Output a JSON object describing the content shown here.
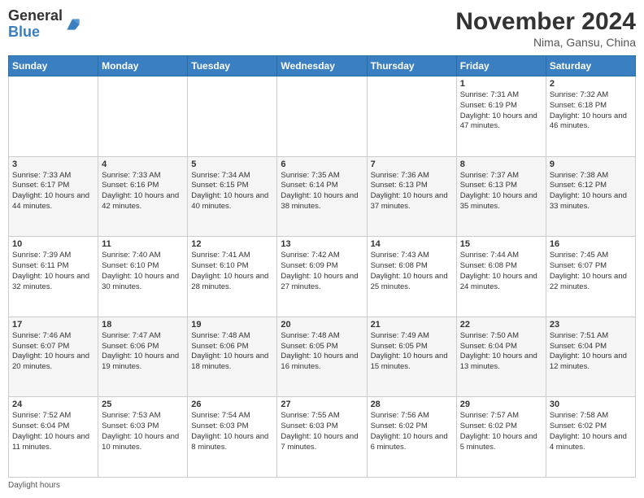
{
  "logo": {
    "general": "General",
    "blue": "Blue"
  },
  "header": {
    "title": "November 2024",
    "subtitle": "Nima, Gansu, China"
  },
  "days_of_week": [
    "Sunday",
    "Monday",
    "Tuesday",
    "Wednesday",
    "Thursday",
    "Friday",
    "Saturday"
  ],
  "weeks": [
    [
      {
        "day": "",
        "info": ""
      },
      {
        "day": "",
        "info": ""
      },
      {
        "day": "",
        "info": ""
      },
      {
        "day": "",
        "info": ""
      },
      {
        "day": "",
        "info": ""
      },
      {
        "day": "1",
        "info": "Sunrise: 7:31 AM\nSunset: 6:19 PM\nDaylight: 10 hours and 47 minutes."
      },
      {
        "day": "2",
        "info": "Sunrise: 7:32 AM\nSunset: 6:18 PM\nDaylight: 10 hours and 46 minutes."
      }
    ],
    [
      {
        "day": "3",
        "info": "Sunrise: 7:33 AM\nSunset: 6:17 PM\nDaylight: 10 hours and 44 minutes."
      },
      {
        "day": "4",
        "info": "Sunrise: 7:33 AM\nSunset: 6:16 PM\nDaylight: 10 hours and 42 minutes."
      },
      {
        "day": "5",
        "info": "Sunrise: 7:34 AM\nSunset: 6:15 PM\nDaylight: 10 hours and 40 minutes."
      },
      {
        "day": "6",
        "info": "Sunrise: 7:35 AM\nSunset: 6:14 PM\nDaylight: 10 hours and 38 minutes."
      },
      {
        "day": "7",
        "info": "Sunrise: 7:36 AM\nSunset: 6:13 PM\nDaylight: 10 hours and 37 minutes."
      },
      {
        "day": "8",
        "info": "Sunrise: 7:37 AM\nSunset: 6:13 PM\nDaylight: 10 hours and 35 minutes."
      },
      {
        "day": "9",
        "info": "Sunrise: 7:38 AM\nSunset: 6:12 PM\nDaylight: 10 hours and 33 minutes."
      }
    ],
    [
      {
        "day": "10",
        "info": "Sunrise: 7:39 AM\nSunset: 6:11 PM\nDaylight: 10 hours and 32 minutes."
      },
      {
        "day": "11",
        "info": "Sunrise: 7:40 AM\nSunset: 6:10 PM\nDaylight: 10 hours and 30 minutes."
      },
      {
        "day": "12",
        "info": "Sunrise: 7:41 AM\nSunset: 6:10 PM\nDaylight: 10 hours and 28 minutes."
      },
      {
        "day": "13",
        "info": "Sunrise: 7:42 AM\nSunset: 6:09 PM\nDaylight: 10 hours and 27 minutes."
      },
      {
        "day": "14",
        "info": "Sunrise: 7:43 AM\nSunset: 6:08 PM\nDaylight: 10 hours and 25 minutes."
      },
      {
        "day": "15",
        "info": "Sunrise: 7:44 AM\nSunset: 6:08 PM\nDaylight: 10 hours and 24 minutes."
      },
      {
        "day": "16",
        "info": "Sunrise: 7:45 AM\nSunset: 6:07 PM\nDaylight: 10 hours and 22 minutes."
      }
    ],
    [
      {
        "day": "17",
        "info": "Sunrise: 7:46 AM\nSunset: 6:07 PM\nDaylight: 10 hours and 20 minutes."
      },
      {
        "day": "18",
        "info": "Sunrise: 7:47 AM\nSunset: 6:06 PM\nDaylight: 10 hours and 19 minutes."
      },
      {
        "day": "19",
        "info": "Sunrise: 7:48 AM\nSunset: 6:06 PM\nDaylight: 10 hours and 18 minutes."
      },
      {
        "day": "20",
        "info": "Sunrise: 7:48 AM\nSunset: 6:05 PM\nDaylight: 10 hours and 16 minutes."
      },
      {
        "day": "21",
        "info": "Sunrise: 7:49 AM\nSunset: 6:05 PM\nDaylight: 10 hours and 15 minutes."
      },
      {
        "day": "22",
        "info": "Sunrise: 7:50 AM\nSunset: 6:04 PM\nDaylight: 10 hours and 13 minutes."
      },
      {
        "day": "23",
        "info": "Sunrise: 7:51 AM\nSunset: 6:04 PM\nDaylight: 10 hours and 12 minutes."
      }
    ],
    [
      {
        "day": "24",
        "info": "Sunrise: 7:52 AM\nSunset: 6:04 PM\nDaylight: 10 hours and 11 minutes."
      },
      {
        "day": "25",
        "info": "Sunrise: 7:53 AM\nSunset: 6:03 PM\nDaylight: 10 hours and 10 minutes."
      },
      {
        "day": "26",
        "info": "Sunrise: 7:54 AM\nSunset: 6:03 PM\nDaylight: 10 hours and 8 minutes."
      },
      {
        "day": "27",
        "info": "Sunrise: 7:55 AM\nSunset: 6:03 PM\nDaylight: 10 hours and 7 minutes."
      },
      {
        "day": "28",
        "info": "Sunrise: 7:56 AM\nSunset: 6:02 PM\nDaylight: 10 hours and 6 minutes."
      },
      {
        "day": "29",
        "info": "Sunrise: 7:57 AM\nSunset: 6:02 PM\nDaylight: 10 hours and 5 minutes."
      },
      {
        "day": "30",
        "info": "Sunrise: 7:58 AM\nSunset: 6:02 PM\nDaylight: 10 hours and 4 minutes."
      }
    ]
  ],
  "footer": {
    "daylight_label": "Daylight hours"
  }
}
